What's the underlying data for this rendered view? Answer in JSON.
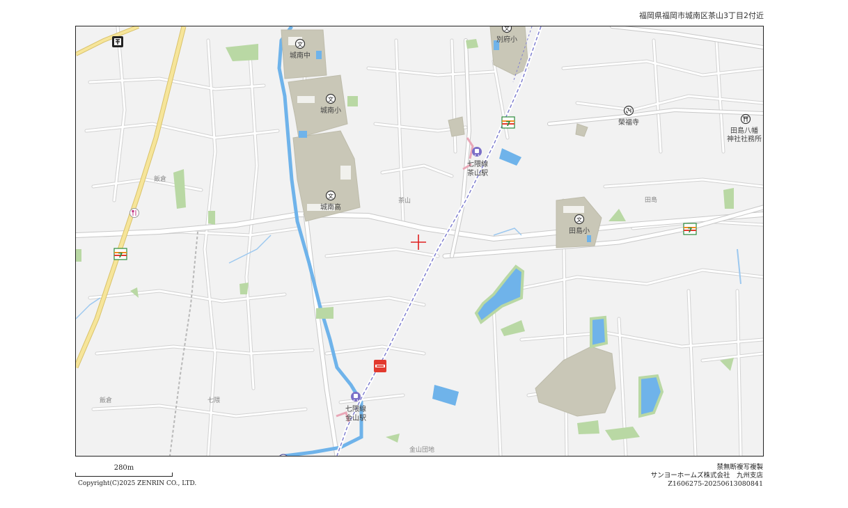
{
  "header": {
    "top_text": "福岡県福岡市城南区茶山3丁目2付近"
  },
  "map": {
    "labels": {
      "jonan_chu": "城南中",
      "jonan_sho": "城南小",
      "jonan_ko": "城南高",
      "beppu_sho": "別府小",
      "nanakuma_line_chayama_1": "七隈線",
      "nanakuma_line_chayama_2": "茶山駅",
      "nanakuma_line_kanayama_1": "七隈線",
      "nanakuma_line_kanayama_2": "金山駅",
      "eifukuji": "榮福寺",
      "tashima_hachiman_1": "田島八幡",
      "tashima_hachiman_2": "神社社務所",
      "tashima_sho": "田島小",
      "tashima": "田島",
      "chayama": "茶山",
      "iikura_1": "飯倉",
      "iikura_2": "飯倉",
      "nanakuma": "七隈",
      "kanayama_danchi": "金山団地"
    },
    "colors": {
      "background": "#f2f2f2",
      "road": "#ffffff",
      "road_edge": "#c8c8c8",
      "water": "#6fb3ea",
      "park": "#b9d8a4",
      "facility": "#c8c6b8",
      "highway": "#f3dd8a",
      "rail": "#7a7ad0",
      "pin": "#e02020"
    },
    "icons": [
      "school-icon",
      "subway-station-icon",
      "temple-icon",
      "shrine-icon",
      "convenience-store-icon",
      "restaurant-icon",
      "post-office-icon"
    ]
  },
  "scale": {
    "label": "280m"
  },
  "footer": {
    "copyright": "Copyright(C)2025 ZENRIN CO., LTD.",
    "line1": "禁無断複写複製",
    "line2": "サンヨーホームズ株式会社　九州支店",
    "line3": "Z1606275-20250613080841"
  }
}
